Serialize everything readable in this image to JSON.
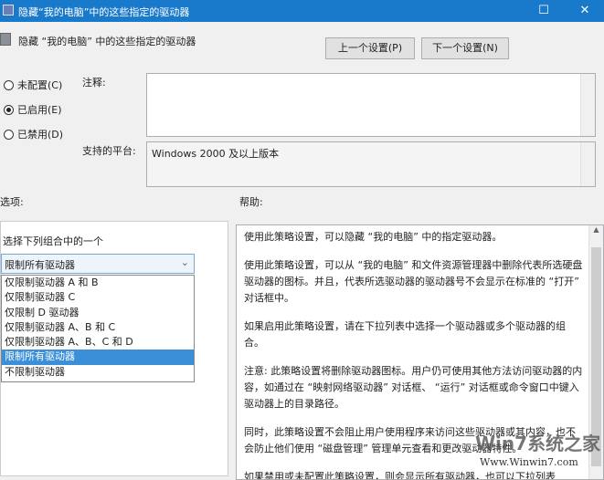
{
  "window": {
    "title": "隐藏“我的电脑”中的这些指定的驱动器",
    "maximize": "☐",
    "close": "✕"
  },
  "header": {
    "policy_name": "隐藏 “我的电脑” 中的这些指定的驱动器",
    "prev_button": "上一个设置(P)",
    "next_button": "下一个设置(N)"
  },
  "state": {
    "options": [
      {
        "label": "未配置(C)",
        "checked": false
      },
      {
        "label": "已启用(E)",
        "checked": true
      },
      {
        "label": "已禁用(D)",
        "checked": false
      }
    ]
  },
  "comment": {
    "label": "注释:",
    "value": ""
  },
  "platform": {
    "label": "支持的平台:",
    "value": "Windows 2000 及以上版本"
  },
  "options_section": {
    "label": "选项:",
    "prompt": "选择下列组合中的一个",
    "selected": "限制所有驱动器",
    "items": [
      "仅限制驱动器 A 和 B",
      "仅限制驱动器 C",
      "仅限制 D 驱动器",
      "仅限制驱动器 A、B 和 C",
      "仅限制驱动器 A、B、C 和 D",
      "限制所有驱动器",
      "不限制驱动器"
    ],
    "highlighted_index": 5
  },
  "help_section": {
    "label": "帮助:",
    "paragraphs": [
      "使用此策略设置，可以隐藏 “我的电脑” 中的指定驱动器。",
      "使用此策略设置，可以从 “我的电脑” 和文件资源管理器中删除代表所选硬盘驱动器的图标。并且，代表所选驱动器的驱动器号不会显示在标准的 “打开” 对话框中。",
      "如果启用此策略设置，请在下拉列表中选择一个驱动器或多个驱动器的组合。",
      "注意: 此策略设置将删除驱动器图标。用户仍可使用其他方法访问驱动器的内容，如通过在 “映射网络驱动器” 对话框、 “运行” 对话框或命令窗口中键入驱动器上的目录路径。",
      "同时，此策略设置不会阻止用户使用程序来访问这些驱动器或其内容，也不会防止他们使用 “磁盘管理” 管理单元查看和更改驱动器特性。",
      "如果禁用或未配置此策略设置，则会显示所有驱动器，也可以下拉列表"
    ]
  },
  "watermark": {
    "brand": "Win7系统之家",
    "url": "Www.Winwin7.com"
  }
}
